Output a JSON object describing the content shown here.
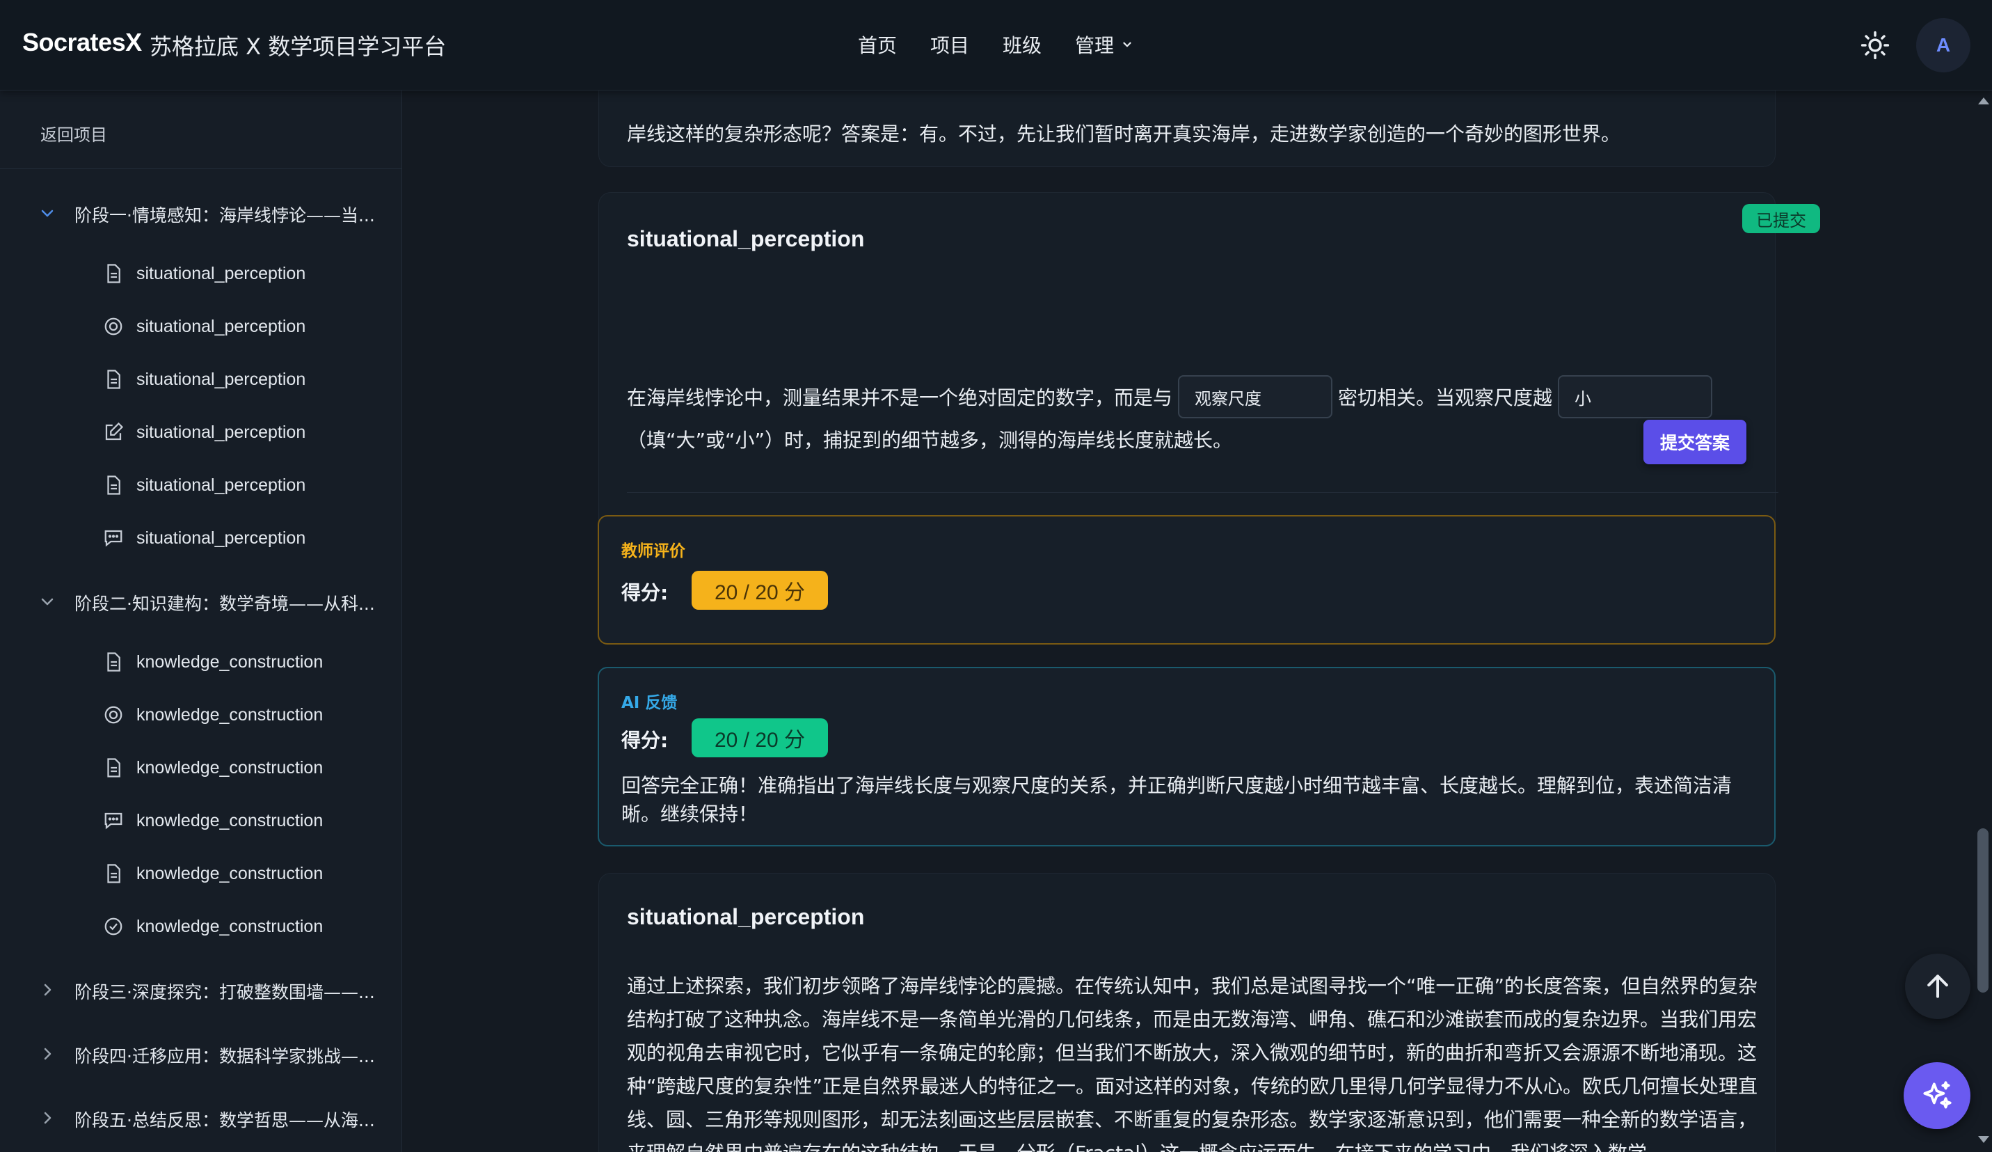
{
  "header": {
    "brand": "SocratesX",
    "subtitle": "苏格拉底 X 数学项目学习平台",
    "nav": [
      "首页",
      "项目",
      "班级",
      "管理"
    ],
    "avatar_letter": "A",
    "theme_icon": "sun-icon"
  },
  "sidebar": {
    "back_label": "返回项目",
    "stages": [
      {
        "label": "阶段一·情境感知：海岸线悖论——当...",
        "expanded": true,
        "tasks": [
          {
            "icon": "document-icon",
            "label": "situational_perception"
          },
          {
            "icon": "target-icon",
            "label": "situational_perception"
          },
          {
            "icon": "document-icon",
            "label": "situational_perception"
          },
          {
            "icon": "edit-icon",
            "label": "situational_perception"
          },
          {
            "icon": "document-icon",
            "label": "situational_perception"
          },
          {
            "icon": "chat-icon",
            "label": "situational_perception"
          }
        ]
      },
      {
        "label": "阶段二·知识建构：数学奇境——从科...",
        "expanded": true,
        "tasks": [
          {
            "icon": "document-icon",
            "label": "knowledge_construction"
          },
          {
            "icon": "target-icon",
            "label": "knowledge_construction"
          },
          {
            "icon": "document-icon",
            "label": "knowledge_construction"
          },
          {
            "icon": "chat-icon",
            "label": "knowledge_construction"
          },
          {
            "icon": "document-icon",
            "label": "knowledge_construction"
          },
          {
            "icon": "check-circle-icon",
            "label": "knowledge_construction"
          }
        ]
      },
      {
        "label": "阶段三·深度探究：打破整数围墙——...",
        "expanded": false
      },
      {
        "label": "阶段四·迁移应用：数据科学家挑战—...",
        "expanded": false
      },
      {
        "label": "阶段五·总结反思：数学哲思——从海...",
        "expanded": false
      }
    ]
  },
  "main": {
    "intro_tail": "岸线这样的复杂形态呢？答案是：有。不过，先让我们暂时离开真实海岸，走进数学家创造的一个奇妙的图形世界。",
    "fill_card": {
      "title": "situational_perception",
      "badge": "已提交",
      "text_1": "在海岸线悖论中，测量结果并不是一个绝对固定的数字，而是与",
      "blank_1": "观察尺度",
      "text_2": "密切相关。当观察尺度越",
      "blank_2": "小",
      "text_3": "（填“大”或“小”）时，捕捉到的细节越多，测得的海岸线长度就越长。",
      "submit_label": "提交答案"
    },
    "teacher_eval": {
      "heading": "教师评价",
      "score_label": "得分:",
      "score": "20 / 20 分"
    },
    "ai_feedback": {
      "heading": "AI 反馈",
      "score_label": "得分:",
      "score": "20 / 20 分",
      "text": "回答完全正确！准确指出了海岸线长度与观察尺度的关系，并正确判断尺度越小时细节越丰富、长度越长。理解到位，表述简洁清晰。继续保持！"
    },
    "reading_card": {
      "title": "situational_perception",
      "paragraph": "通过上述探索，我们初步领略了海岸线悖论的震撼。在传统认知中，我们总是试图寻找一个“唯一正确”的长度答案，但自然界的复杂结构打破了这种执念。海岸线不是一条简单光滑的几何线条，而是由无数海湾、岬角、礁石和沙滩嵌套而成的复杂边界。当我们用宏观的视角去审视它时，它似乎有一条确定的轮廓；但当我们不断放大，深入微观的细节时，新的曲折和弯折又会源源不断地涌现。这种“跨越尺度的复杂性”正是自然界最迷人的特征之一。面对这样的对象，传统的欧几里得几何学显得力不从心。欧氏几何擅长处理直线、圆、三角形等规则图形，却无法刻画这些层层嵌套、不断重复的复杂形态。数学家逐渐意识到，他们需要一种全新的数学语言，来理解自然界中普遍存在的这种结构。于是，分形（Fractal）这一概念应运而生。在接下来的学习中，我们将深入数学"
    }
  },
  "colors": {
    "accent": "#5b4ee8",
    "teacher": "#f5b21b",
    "ai": "#10c68a",
    "success_badge": "#10b981"
  }
}
